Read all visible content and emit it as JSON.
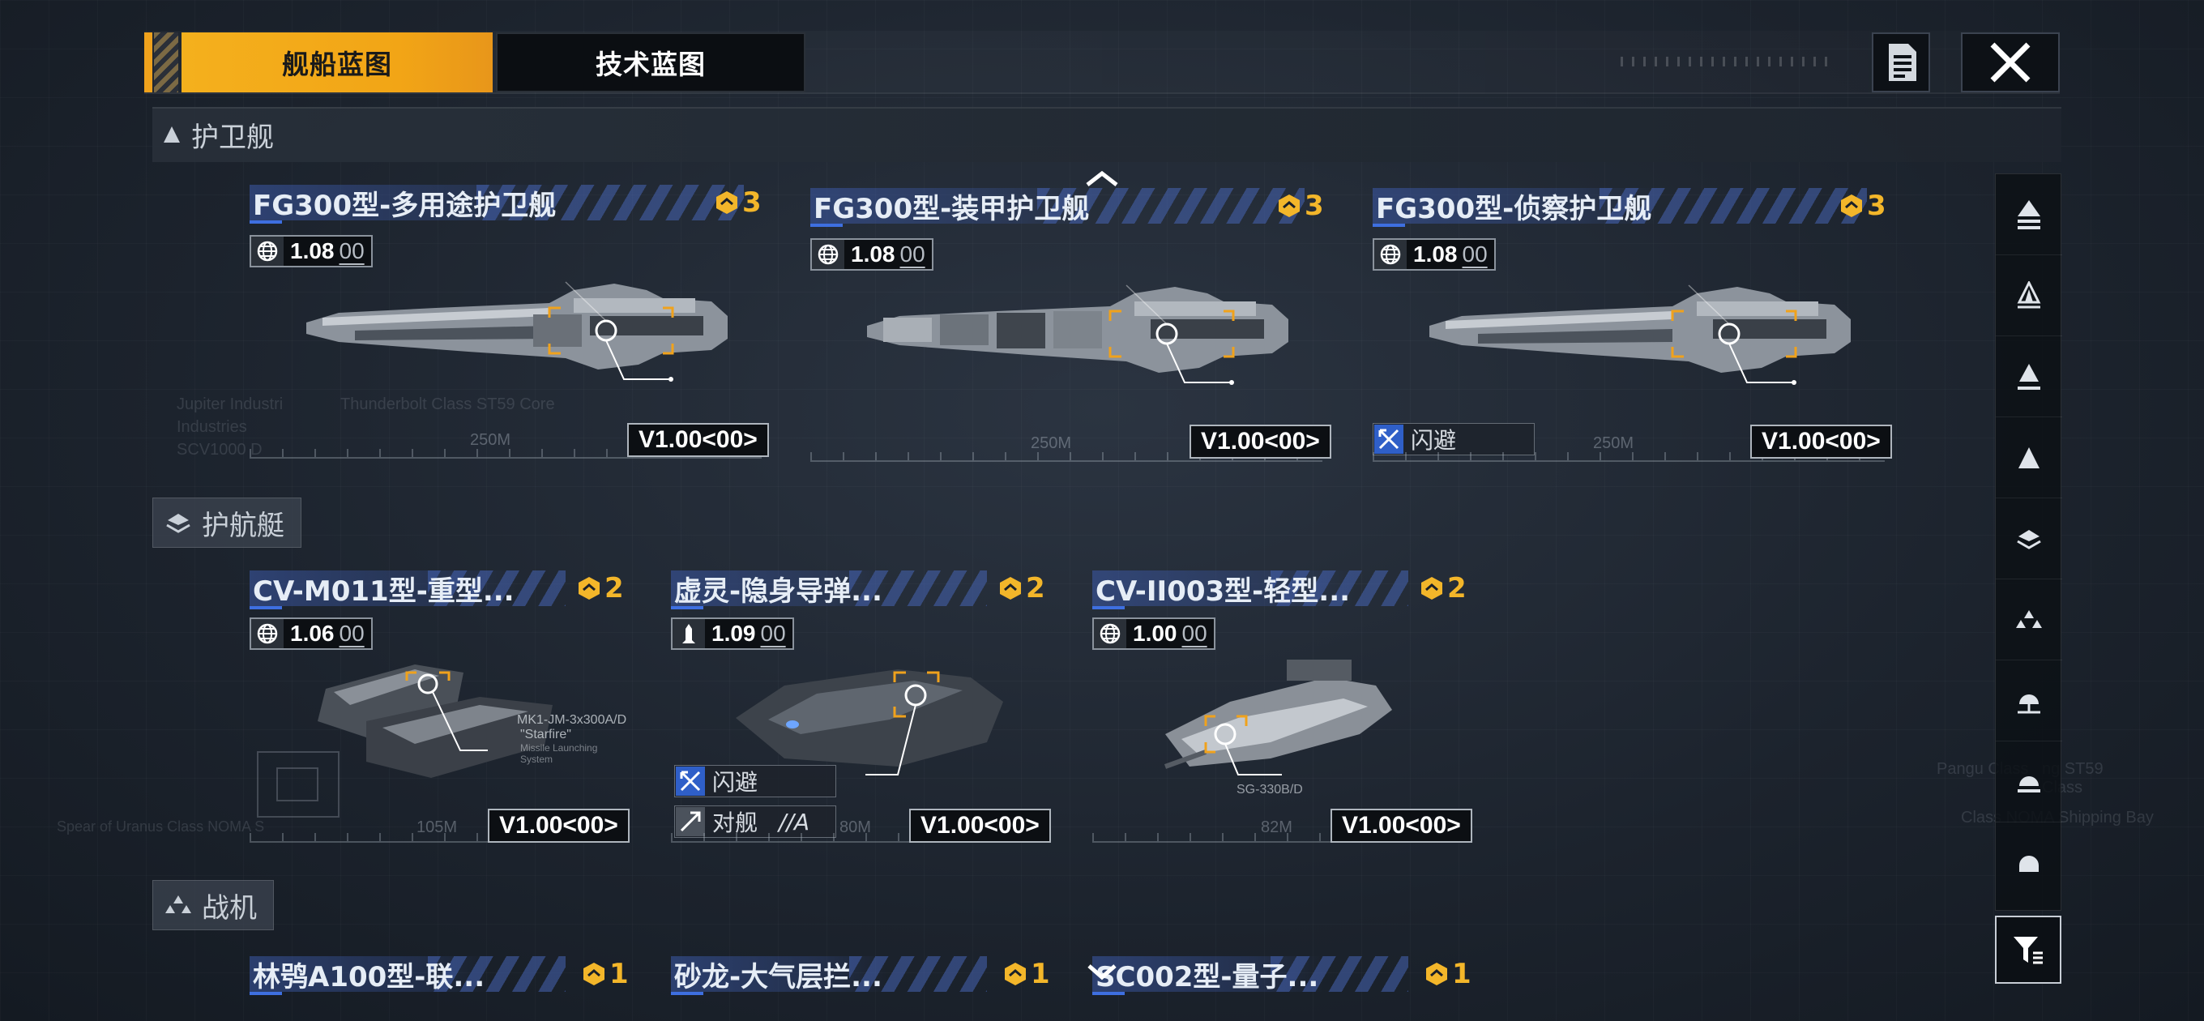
{
  "tabs": {
    "ship_blueprint": "舰船蓝图",
    "tech_blueprint": "技术蓝图"
  },
  "icons": {
    "document": "document-list-icon",
    "close": "close-x-icon",
    "filter": "filter-funnel-icon",
    "tier": "hexagon-rank-icon",
    "globe": "globe-icon",
    "missile": "missile-icon"
  },
  "colors": {
    "accent": "#f2a516",
    "tier_gold": "#f3b62a",
    "title_blue": "#3e6fe0"
  },
  "sections": {
    "frigate": {
      "label": "护卫舰",
      "icon": "triangle-up-icon"
    },
    "corvette": {
      "label": "护航艇",
      "icon": "corvette-layers-icon"
    },
    "fighter": {
      "label": "战机",
      "icon": "fighter-cluster-icon"
    }
  },
  "frigates": [
    {
      "title": "FG300型-多用途护卫舰",
      "tier": "3",
      "ver_num": "1.08",
      "ver_sub": "00",
      "version": "V1.00<00>",
      "scale": "250M"
    },
    {
      "title": "FG300型-装甲护卫舰",
      "tier": "3",
      "ver_num": "1.08",
      "ver_sub": "00",
      "version": "V1.00<00>",
      "scale": "250M"
    },
    {
      "title": "FG300型-侦察护卫舰",
      "tier": "3",
      "ver_num": "1.08",
      "ver_sub": "00",
      "version": "V1.00<00>",
      "scale": "250M",
      "tag": "闪避"
    }
  ],
  "corvettes": [
    {
      "title": "CV-M011型-重型...",
      "tier": "2",
      "ver_num": "1.06",
      "ver_sub": "00",
      "version": "V1.00<00>",
      "scale": "105M",
      "callout": "MK1-JM-3x300A/D",
      "callout2": "\"Starfire\"",
      "callout3": "Missile Launching System"
    },
    {
      "title": "虚灵-隐身导弹...",
      "tier": "2",
      "ver_num": "1.09",
      "ver_sub": "00",
      "version": "V1.00<00>",
      "scale": "80M",
      "tag1": "闪避",
      "tag2": "对舰",
      "tag2_suffix": "//A"
    },
    {
      "title": "CV-II003型-轻型...",
      "tier": "2",
      "ver_num": "1.00",
      "ver_sub": "00",
      "version": "V1.00<00>",
      "scale": "82M",
      "callout": "SG-330B/D"
    }
  ],
  "fighters": [
    {
      "title": "林鸮A100型-联...",
      "tier": "1"
    },
    {
      "title": "砂龙-大气层拦...",
      "tier": "1"
    },
    {
      "title": "SC002型-量子...",
      "tier": "1"
    }
  ],
  "background_text": {
    "left_ghost": "Spear of Uranus Class NOMA S",
    "right_ghost_1": "Pangu Class",
    "right_ghost_2": "ng ST59 Class",
    "right_ghost_3": "Class NOMA Shipping Bay",
    "frigate_ghost_1": "Jupiter Industri",
    "frigate_ghost_2": "Thunderbolt Class ST59 Core",
    "frigate_ghost_3": "Industries",
    "frigate_ghost_4": "SCV1000 D"
  }
}
